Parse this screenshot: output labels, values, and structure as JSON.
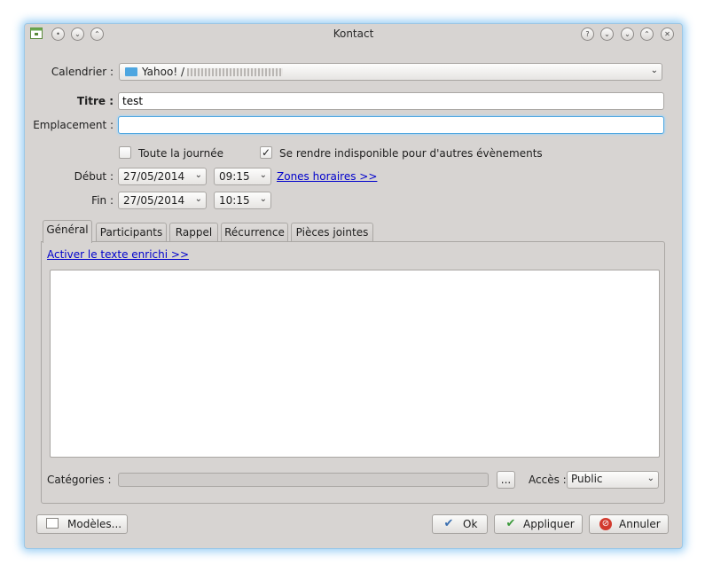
{
  "window": {
    "title": "Kontact"
  },
  "form": {
    "calendar": {
      "label": "Calendrier :",
      "value": "Yahoo! /"
    },
    "title_field": {
      "label": "Titre :",
      "value": "test"
    },
    "location": {
      "label": "Emplacement :",
      "value": ""
    },
    "all_day": {
      "label": "Toute la journée",
      "checked": false
    },
    "busy": {
      "label": "Se rendre indisponible pour d'autres évènements",
      "checked": true
    },
    "start": {
      "label": "Début :",
      "date": "27/05/2014",
      "time": "09:15"
    },
    "end": {
      "label": "Fin :",
      "date": "27/05/2014",
      "time": "10:15"
    },
    "timezones_link": "Zones horaires >>"
  },
  "tabs": [
    {
      "label": "Général",
      "active": true
    },
    {
      "label": "Participants",
      "active": false
    },
    {
      "label": "Rappel",
      "active": false
    },
    {
      "label": "Récurrence",
      "active": false
    },
    {
      "label": "Pièces jointes",
      "active": false
    }
  ],
  "general": {
    "rich_text_link": "Activer le texte enrichi >>",
    "description": "",
    "categories_label": "Catégories :",
    "categories_button": "...",
    "access_label": "Accès :",
    "access_value": "Public"
  },
  "buttons": {
    "templates": "Modèles...",
    "ok": "Ok",
    "apply": "Appliquer",
    "cancel": "Annuler"
  },
  "icons": {
    "window": "calendar-icon",
    "folder": "folder-icon",
    "ok": "check-icon",
    "apply": "check-icon",
    "cancel": "cancel-icon",
    "templates": "template-icon"
  },
  "colors": {
    "window_bg": "#d7d4d2",
    "focus": "#4ea6e0",
    "link": "#0000cc",
    "glow": "#78bef0"
  }
}
